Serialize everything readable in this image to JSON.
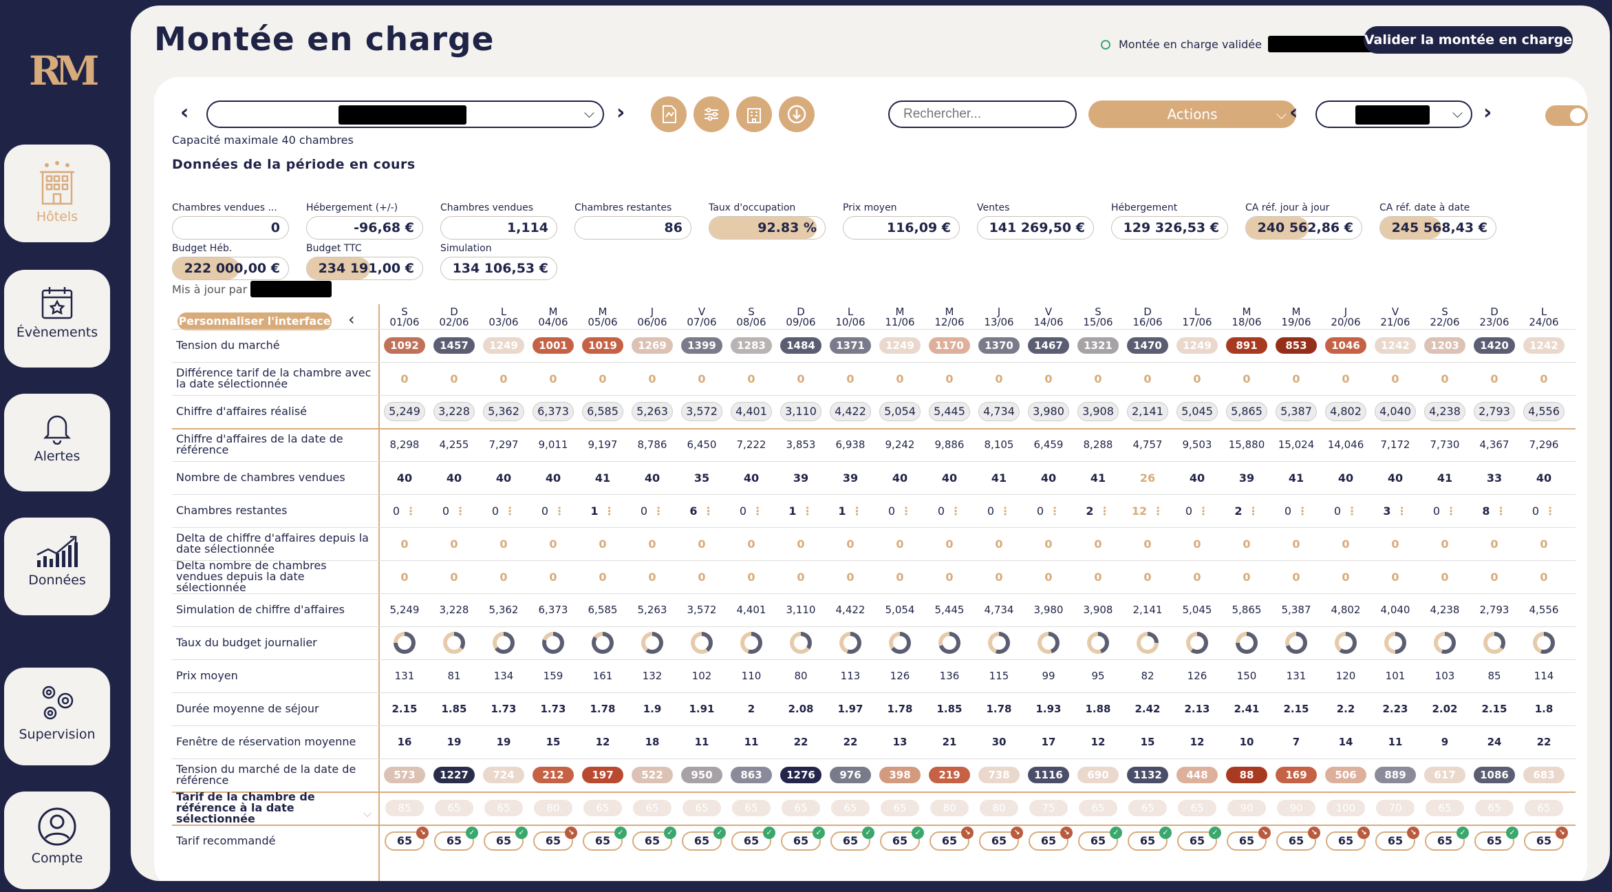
{
  "sidebar": {
    "items": [
      {
        "label": "Hôtels",
        "icon": "hotel-icon"
      },
      {
        "label": "Évènements",
        "icon": "calendar-icon"
      },
      {
        "label": "Alertes",
        "icon": "bell-icon"
      },
      {
        "label": "Données",
        "icon": "chart-icon"
      },
      {
        "label": "Supervision",
        "icon": "gears-icon"
      },
      {
        "label": "Compte",
        "icon": "user-icon"
      }
    ]
  },
  "header": {
    "title": "Montée en charge",
    "validated_text": "Montée en charge validée",
    "validate_button": "Valider la montée en charge"
  },
  "toolbar": {
    "search_placeholder": "Rechercher...",
    "actions_label": "Actions"
  },
  "capacity": "Capacité maximale 40 chambres",
  "section_title": "Données de la période en cours",
  "kpis": [
    {
      "label": "Chambres vendues ...",
      "value": "0"
    },
    {
      "label": "Hébergement (+/-)",
      "value": "-96,68 €"
    },
    {
      "label": "Chambres vendues",
      "value": "1,114"
    },
    {
      "label": "Chambres restantes",
      "value": "86"
    },
    {
      "label": "Taux d'occupation",
      "value": "92.83 %",
      "fill": 0.9283
    },
    {
      "label": "Prix moyen",
      "value": "116,09 €"
    },
    {
      "label": "Ventes",
      "value": "141 269,50 €"
    },
    {
      "label": "Hébergement",
      "value": "129 326,53 €"
    },
    {
      "label": "CA réf. jour à jour",
      "value": "240 562,86 €",
      "fill": 0.54
    },
    {
      "label": "CA réf. date à date",
      "value": "245 568,43 €",
      "fill": 0.53
    },
    {
      "label": "Budget Héb.",
      "value": "222 000,00 €",
      "fill": 0.58
    },
    {
      "label": "Budget TTC",
      "value": "234 191,00 €",
      "fill": 0.55
    },
    {
      "label": "Simulation",
      "value": "134 106,53 €"
    }
  ],
  "updated_by": "Mis à jour par",
  "grid": {
    "customize_label": "Personnaliser l'interface",
    "days": [
      "S",
      "D",
      "L",
      "M",
      "M",
      "J",
      "V",
      "S",
      "D",
      "L",
      "M",
      "M",
      "J",
      "V",
      "S",
      "D",
      "L",
      "M",
      "M",
      "J",
      "V",
      "S",
      "D",
      "L"
    ],
    "dates": [
      "01/06",
      "02/06",
      "03/06",
      "04/06",
      "05/06",
      "06/06",
      "07/06",
      "08/06",
      "09/06",
      "10/06",
      "11/06",
      "12/06",
      "13/06",
      "14/06",
      "15/06",
      "16/06",
      "17/06",
      "18/06",
      "19/06",
      "20/06",
      "21/06",
      "22/06",
      "23/06",
      "24/06"
    ],
    "row_labels": [
      "Tension du marché",
      "Différence tarif de la chambre avec la date sélectionnée",
      "Chiffre d'affaires réalisé",
      "Chiffre d'affaires de la date de référence",
      "Nombre de chambres vendues",
      "Chambres restantes",
      "Delta de chiffre d'affaires depuis la date sélectionnée",
      "Delta nombre de chambres vendues depuis la date sélectionnée",
      "Simulation de chiffre d'affaires",
      "Taux du budget journalier",
      "Prix moyen",
      "Durée moyenne de séjour",
      "Fenêtre de réservation moyenne",
      "Tension du marché de la date de référence",
      "Tarif de la chambre de référence à la date sélectionnée",
      "Tarif recommandé"
    ],
    "tension": [
      "1092",
      "1457",
      "1249",
      "1001",
      "1019",
      "1269",
      "1399",
      "1283",
      "1484",
      "1371",
      "1249",
      "1170",
      "1370",
      "1467",
      "1321",
      "1470",
      "1249",
      "891",
      "853",
      "1046",
      "1242",
      "1203",
      "1420",
      "1242"
    ],
    "tension_colors": [
      "#c07258",
      "#5b5e72",
      "#ead8cc",
      "#c56245",
      "#c56245",
      "#dcc2b4",
      "#7a7b8a",
      "#b9b3b3",
      "#5b5e72",
      "#7a7b8a",
      "#ead8cc",
      "#ddb09c",
      "#7a7b8a",
      "#5b5e72",
      "#a7a2a6",
      "#5b5e72",
      "#ead8cc",
      "#a83a22",
      "#952f1a",
      "#c56245",
      "#ead8cc",
      "#dcc2b4",
      "#5b5e72",
      "#ead8cc"
    ],
    "diff": [
      "0",
      "0",
      "0",
      "0",
      "0",
      "0",
      "0",
      "0",
      "0",
      "0",
      "0",
      "0",
      "0",
      "0",
      "0",
      "0",
      "0",
      "0",
      "0",
      "0",
      "0",
      "0",
      "0",
      "0"
    ],
    "ca_realise": [
      "5,249",
      "3,228",
      "5,362",
      "6,373",
      "6,585",
      "5,263",
      "3,572",
      "4,401",
      "3,110",
      "4,422",
      "5,054",
      "5,445",
      "4,734",
      "3,980",
      "3,908",
      "2,141",
      "5,045",
      "5,865",
      "5,387",
      "4,802",
      "4,040",
      "4,238",
      "2,793",
      "4,556"
    ],
    "ca_ref": [
      "8,298",
      "4,255",
      "7,297",
      "9,011",
      "9,197",
      "8,786",
      "6,450",
      "7,222",
      "3,853",
      "6,938",
      "9,242",
      "9,886",
      "8,105",
      "6,459",
      "8,288",
      "4,757",
      "9,503",
      "15,880",
      "15,024",
      "14,046",
      "7,172",
      "7,730",
      "4,367",
      "7,296"
    ],
    "vendues": [
      "40",
      "40",
      "40",
      "40",
      "41",
      "40",
      "35",
      "40",
      "39",
      "39",
      "40",
      "40",
      "41",
      "40",
      "41",
      "26",
      "40",
      "39",
      "41",
      "40",
      "40",
      "41",
      "33",
      "40"
    ],
    "restantes": [
      "0",
      "0",
      "0",
      "0",
      "1",
      "0",
      "6",
      "0",
      "1",
      "1",
      "0",
      "0",
      "0",
      "0",
      "2",
      "12",
      "0",
      "2",
      "0",
      "0",
      "3",
      "0",
      "8",
      "0"
    ],
    "delta_ca": [
      "0",
      "0",
      "0",
      "0",
      "0",
      "0",
      "0",
      "0",
      "0",
      "0",
      "0",
      "0",
      "0",
      "0",
      "0",
      "0",
      "0",
      "0",
      "0",
      "0",
      "0",
      "0",
      "0",
      "0"
    ],
    "delta_nb": [
      "0",
      "0",
      "0",
      "0",
      "0",
      "0",
      "0",
      "0",
      "0",
      "0",
      "0",
      "0",
      "0",
      "0",
      "0",
      "0",
      "0",
      "0",
      "0",
      "0",
      "0",
      "0",
      "0",
      "0"
    ],
    "simulation": [
      "5,249",
      "3,228",
      "5,362",
      "6,373",
      "6,585",
      "5,263",
      "3,572",
      "4,401",
      "3,110",
      "4,422",
      "5,054",
      "5,445",
      "4,734",
      "3,980",
      "3,908",
      "2,141",
      "5,045",
      "5,865",
      "5,387",
      "4,802",
      "4,040",
      "4,238",
      "2,793",
      "4,556"
    ],
    "budget_rate": [
      0.75,
      0.35,
      0.65,
      0.8,
      0.85,
      0.6,
      0.4,
      0.55,
      0.35,
      0.55,
      0.65,
      0.7,
      0.55,
      0.45,
      0.45,
      0.25,
      0.6,
      0.75,
      0.7,
      0.6,
      0.5,
      0.55,
      0.35,
      0.55
    ],
    "prix_moyen": [
      "131",
      "81",
      "134",
      "159",
      "161",
      "132",
      "102",
      "110",
      "80",
      "113",
      "126",
      "136",
      "115",
      "99",
      "95",
      "82",
      "126",
      "150",
      "131",
      "120",
      "101",
      "103",
      "85",
      "114"
    ],
    "duree": [
      "2.15",
      "1.85",
      "1.73",
      "1.73",
      "1.78",
      "1.9",
      "1.91",
      "2",
      "2.08",
      "1.97",
      "1.78",
      "1.85",
      "1.78",
      "1.93",
      "1.88",
      "2.42",
      "2.13",
      "2.41",
      "2.15",
      "2.2",
      "2.23",
      "2.02",
      "2.15",
      "1.8"
    ],
    "fenetre": [
      "16",
      "19",
      "19",
      "15",
      "12",
      "18",
      "11",
      "11",
      "22",
      "22",
      "13",
      "21",
      "30",
      "17",
      "12",
      "15",
      "12",
      "10",
      "7",
      "14",
      "11",
      "9",
      "24",
      "22"
    ],
    "tension_ref": [
      "573",
      "1227",
      "724",
      "212",
      "197",
      "522",
      "950",
      "863",
      "1276",
      "976",
      "398",
      "219",
      "738",
      "1116",
      "690",
      "1132",
      "448",
      "88",
      "169",
      "506",
      "889",
      "617",
      "1086",
      "683"
    ],
    "tension_ref_colors": [
      "#dcc2b4",
      "#2a2d4a",
      "#ead8cc",
      "#c56245",
      "#b94a30",
      "#dcc2b4",
      "#a7a2a6",
      "#8a8a9a",
      "#23264a",
      "#7a7b8a",
      "#d39a80",
      "#c56245",
      "#ead8cc",
      "#4b4e68",
      "#ead8cc",
      "#4b4e68",
      "#ddb09c",
      "#a83a22",
      "#c56245",
      "#ddb09c",
      "#8a8a9a",
      "#ead8cc",
      "#5b5e72",
      "#ead8cc"
    ],
    "tarif_ref": [
      "85",
      "65",
      "65",
      "80",
      "65",
      "65",
      "65",
      "65",
      "65",
      "65",
      "65",
      "80",
      "80",
      "75",
      "65",
      "65",
      "65",
      "90",
      "90",
      "100",
      "70",
      "65",
      "65",
      "65"
    ],
    "tarif_reco": [
      "65",
      "65",
      "65",
      "65",
      "65",
      "65",
      "65",
      "65",
      "65",
      "65",
      "65",
      "65",
      "65",
      "65",
      "65",
      "65",
      "65",
      "65",
      "65",
      "65",
      "65",
      "65",
      "65",
      "65"
    ],
    "reco_badges": [
      "down",
      "up",
      "up",
      "down",
      "up",
      "up",
      "up",
      "up",
      "up",
      "up",
      "up",
      "down",
      "down",
      "down",
      "up",
      "up",
      "up",
      "down",
      "down",
      "down",
      "down",
      "up",
      "up",
      "down"
    ]
  }
}
